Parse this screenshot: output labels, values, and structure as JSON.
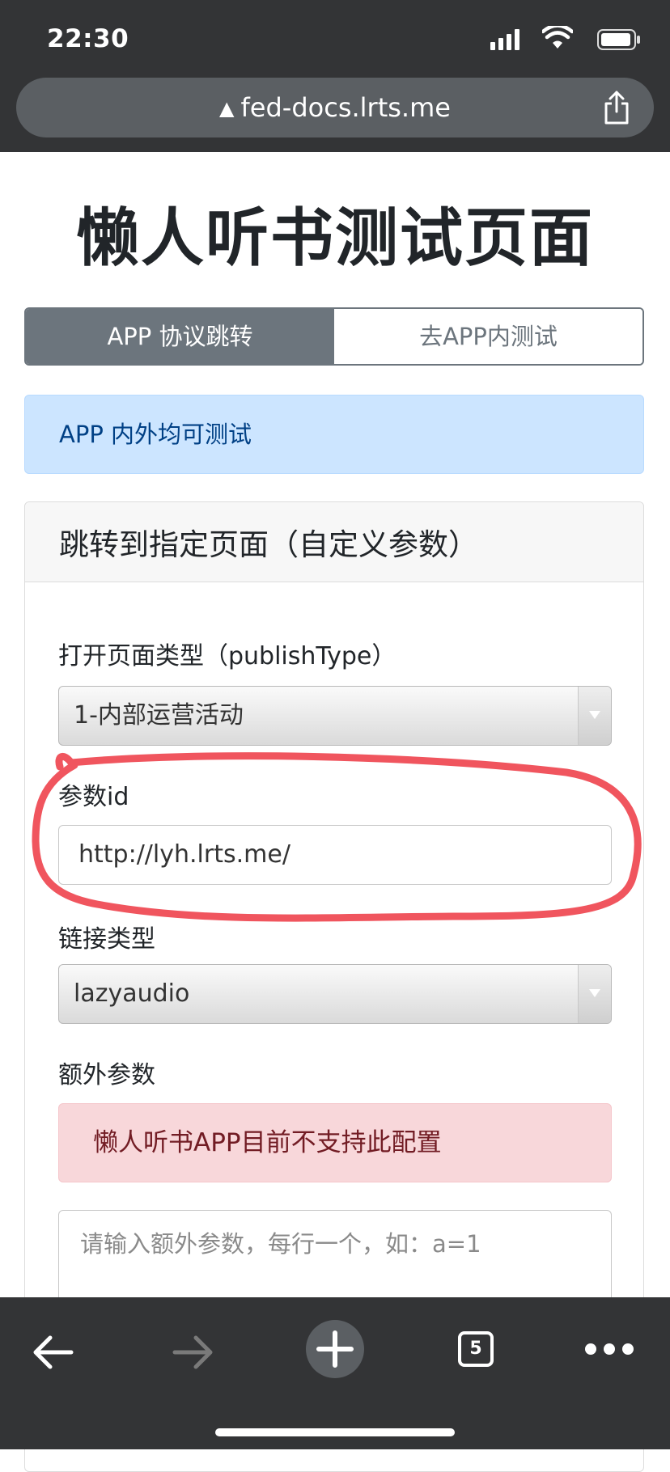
{
  "status_bar": {
    "time": "22:30"
  },
  "browser": {
    "url": "fed-docs.lrts.me",
    "tab_count": "5"
  },
  "page": {
    "title": "懒人听书测试页面",
    "tabs": [
      {
        "label": "APP 协议跳转",
        "active": true
      },
      {
        "label": "去APP内测试",
        "active": false
      }
    ],
    "info_alert": "APP 内外均可测试",
    "card": {
      "header": "跳转到指定页面（自定义参数）",
      "publish_type": {
        "label": "打开页面类型（publishType）",
        "value": "1-内部运营活动"
      },
      "param_id": {
        "label": "参数id",
        "value": "http://lyh.lrts.me/"
      },
      "link_type": {
        "label": "链接类型",
        "value": "lazyaudio"
      },
      "extra_params": {
        "label": "额外参数",
        "warning": "懒人听书APP目前不支持此配置",
        "placeholder": "请输入额外参数，每行一个，如：a=1"
      }
    }
  },
  "colors": {
    "chrome": "#333436",
    "tab_active": "#6c757d",
    "info_bg": "#cce5ff",
    "danger_bg": "#f8d7da",
    "annotation": "#f0555e"
  }
}
